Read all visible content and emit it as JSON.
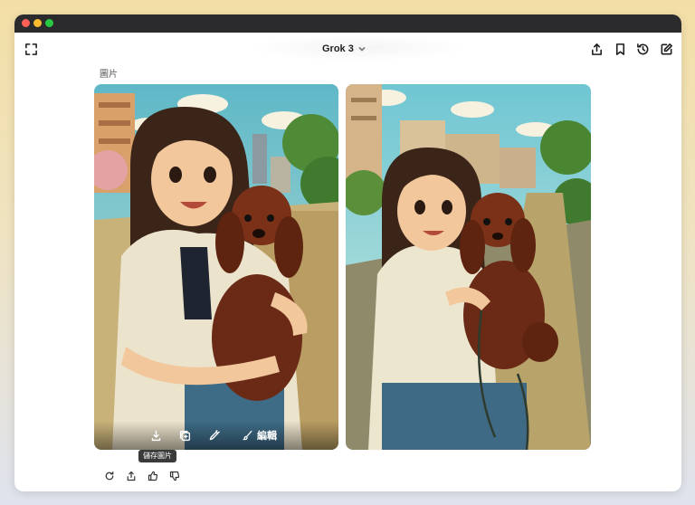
{
  "header": {
    "model_name": "Grok 3"
  },
  "section": {
    "label": "圖片"
  },
  "image_toolbar": {
    "edit_label": "編輯",
    "save_tooltip": "儲存圖片"
  },
  "icons": {
    "window_controls": [
      "close",
      "minimize",
      "maximize"
    ],
    "header_left": "expand-icon",
    "header_right": [
      "share-icon",
      "bookmark-icon",
      "history-icon",
      "new-chat-icon"
    ],
    "image_actions": [
      "download-icon",
      "add-image-icon",
      "pen-icon",
      "brush-icon"
    ],
    "message_actions": [
      "regenerate-icon",
      "share-icon",
      "thumbs-up-icon",
      "thumbs-down-icon"
    ]
  },
  "colors": {
    "window_bg": "#ffffff",
    "titlebar": "#2b2b2d",
    "accent_text": "#1f1f1f"
  }
}
